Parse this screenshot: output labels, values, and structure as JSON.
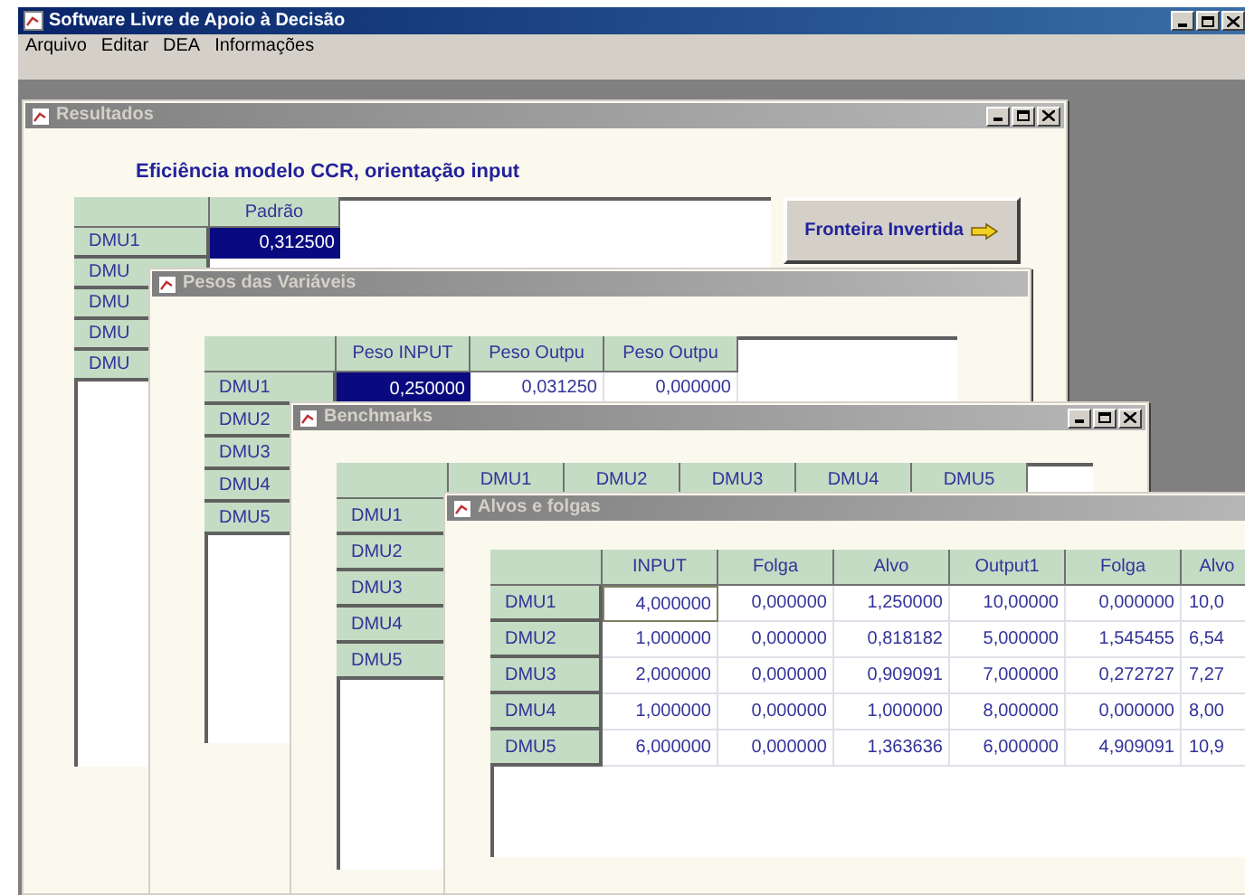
{
  "window": {
    "title": "Software Livre de Apoio à Decisão"
  },
  "menu": [
    {
      "label": "Arquivo"
    },
    {
      "label": "Editar"
    },
    {
      "label": "DEA"
    },
    {
      "label": "Informações"
    }
  ],
  "windows": [
    {
      "title": "Resultados",
      "controls": true,
      "heading": "Eficiência modelo CCR, orientação input",
      "button": "Fronteira Invertida",
      "table": {
        "columns": [
          "Padrão"
        ],
        "rows": [
          {
            "label": "DMU1",
            "cells": [
              {
                "text": "0,312500",
                "selected": true
              }
            ]
          },
          {
            "label": "DMU",
            "cells": []
          },
          {
            "label": "DMU",
            "cells": []
          },
          {
            "label": "DMU",
            "cells": []
          },
          {
            "label": "DMU",
            "cells": []
          }
        ]
      }
    },
    {
      "title": "Pesos das Variáveis",
      "controls": false,
      "table": {
        "columns": [
          "Peso INPUT",
          "Peso Outpu",
          "Peso Outpu"
        ],
        "rows": [
          {
            "label": "DMU1",
            "cells": [
              {
                "text": "0,250000",
                "selected": true
              },
              {
                "text": "0,031250",
                "selected": false
              },
              {
                "text": "0,000000",
                "selected": false
              }
            ]
          },
          {
            "label": "DMU2",
            "cells": []
          },
          {
            "label": "DMU3",
            "cells": []
          },
          {
            "label": "DMU4",
            "cells": []
          },
          {
            "label": "DMU5",
            "cells": []
          }
        ]
      }
    },
    {
      "title": "Benchmarks",
      "controls": true,
      "table": {
        "columns": [
          "DMU1",
          "DMU2",
          "DMU3",
          "DMU4",
          "DMU5"
        ],
        "rows": [
          {
            "label": "DMU1",
            "cells": []
          },
          {
            "label": "DMU2",
            "cells": []
          },
          {
            "label": "DMU3",
            "cells": []
          },
          {
            "label": "DMU4",
            "cells": []
          },
          {
            "label": "DMU5",
            "cells": []
          }
        ]
      }
    },
    {
      "title": "Alvos e folgas",
      "controls": false,
      "table": {
        "columns": [
          "INPUT",
          "Folga",
          "Alvo",
          "Output1",
          "Folga",
          "Alvo"
        ],
        "rows": [
          {
            "label": "DMU1",
            "cells": [
              {
                "text": "4,000000",
                "selected": true
              },
              {
                "text": "0,000000",
                "selected": false
              },
              {
                "text": "1,250000",
                "selected": false
              },
              {
                "text": "10,00000",
                "selected": false
              },
              {
                "text": "0,000000",
                "selected": false
              },
              {
                "text": "10,0",
                "selected": false
              }
            ]
          },
          {
            "label": "DMU2",
            "cells": [
              {
                "text": "1,000000",
                "selected": false
              },
              {
                "text": "0,000000",
                "selected": false
              },
              {
                "text": "0,818182",
                "selected": false
              },
              {
                "text": "5,000000",
                "selected": false
              },
              {
                "text": "1,545455",
                "selected": false
              },
              {
                "text": "6,54",
                "selected": false
              }
            ]
          },
          {
            "label": "DMU3",
            "cells": [
              {
                "text": "2,000000",
                "selected": false
              },
              {
                "text": "0,000000",
                "selected": false
              },
              {
                "text": "0,909091",
                "selected": false
              },
              {
                "text": "7,000000",
                "selected": false
              },
              {
                "text": "0,272727",
                "selected": false
              },
              {
                "text": "7,27",
                "selected": false
              }
            ]
          },
          {
            "label": "DMU4",
            "cells": [
              {
                "text": "1,000000",
                "selected": false
              },
              {
                "text": "0,000000",
                "selected": false
              },
              {
                "text": "1,000000",
                "selected": false
              },
              {
                "text": "8,000000",
                "selected": false
              },
              {
                "text": "0,000000",
                "selected": false
              },
              {
                "text": "8,00",
                "selected": false
              }
            ]
          },
          {
            "label": "DMU5",
            "cells": [
              {
                "text": "6,000000",
                "selected": false
              },
              {
                "text": "0,000000",
                "selected": false
              },
              {
                "text": "1,363636",
                "selected": false
              },
              {
                "text": "6,000000",
                "selected": false
              },
              {
                "text": "4,909091",
                "selected": false
              },
              {
                "text": "10,9",
                "selected": false
              }
            ]
          }
        ]
      }
    }
  ]
}
